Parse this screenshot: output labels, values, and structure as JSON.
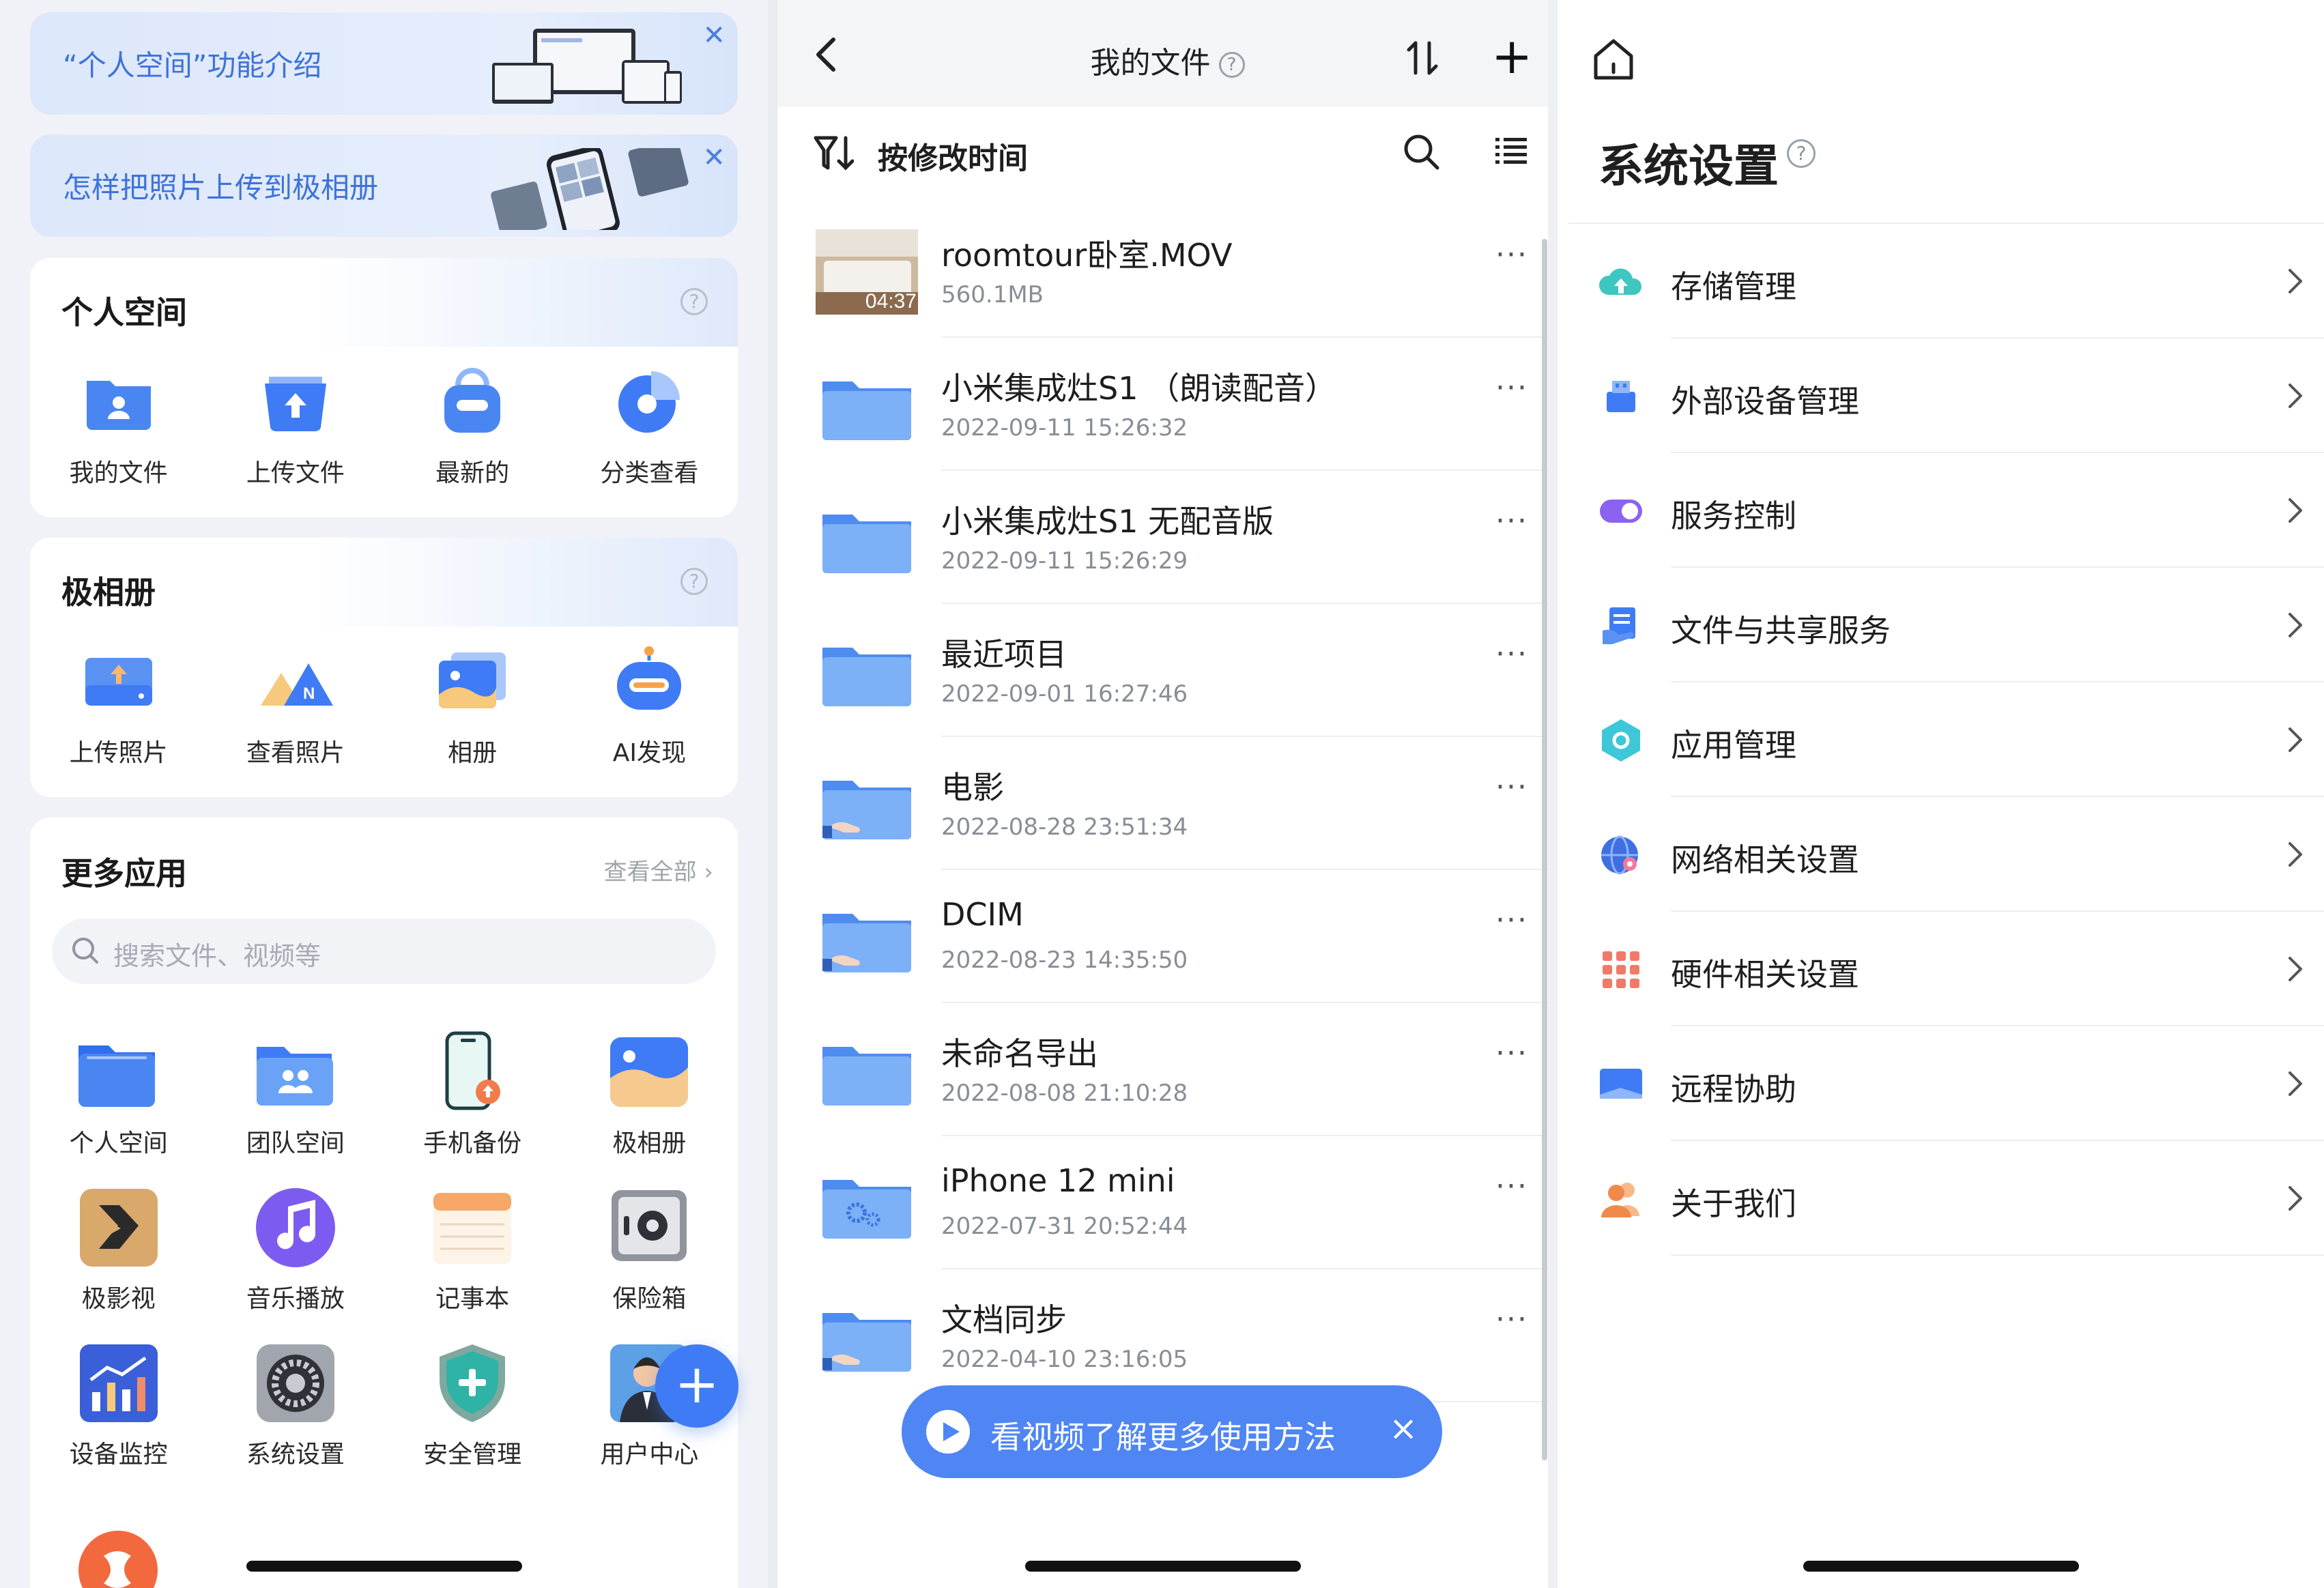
{
  "left_panel": {
    "banners": [
      {
        "text": "“个人空间”功能介绍"
      },
      {
        "text": "怎样把照片上传到极相册"
      }
    ],
    "personal_space": {
      "title": "个人空间",
      "items": [
        {
          "label": "我的文件",
          "icon": "my-files-icon"
        },
        {
          "label": "上传文件",
          "icon": "upload-file-icon"
        },
        {
          "label": "最新的",
          "icon": "recent-icon"
        },
        {
          "label": "分类查看",
          "icon": "category-icon"
        }
      ]
    },
    "album": {
      "title": "极相册",
      "items": [
        {
          "label": "上传照片",
          "icon": "upload-photo-icon"
        },
        {
          "label": "查看照片",
          "icon": "view-photos-icon"
        },
        {
          "label": "相册",
          "icon": "album-icon"
        },
        {
          "label": "AI发现",
          "icon": "ai-discover-icon"
        }
      ]
    },
    "more_apps": {
      "title": "更多应用",
      "view_all": "查看全部",
      "search_placeholder": "搜索文件、视频等",
      "items": [
        {
          "label": "个人空间",
          "icon": "personal-space-icon"
        },
        {
          "label": "团队空间",
          "icon": "team-space-icon"
        },
        {
          "label": "手机备份",
          "icon": "phone-backup-icon"
        },
        {
          "label": "极相册",
          "icon": "photo-album-icon"
        },
        {
          "label": "极影视",
          "icon": "video-icon"
        },
        {
          "label": "音乐播放",
          "icon": "music-icon"
        },
        {
          "label": "记事本",
          "icon": "notepad-icon"
        },
        {
          "label": "保险箱",
          "icon": "safe-icon"
        },
        {
          "label": "设备监控",
          "icon": "monitor-icon"
        },
        {
          "label": "系统设置",
          "icon": "settings-icon"
        },
        {
          "label": "安全管理",
          "icon": "security-icon"
        },
        {
          "label": "用户中心",
          "icon": "user-center-icon"
        }
      ]
    },
    "fab_label": "+"
  },
  "middle_panel": {
    "title": "我的文件",
    "add_label": "+",
    "sort_label": "按修改时间",
    "files": [
      {
        "name": "roomtour卧室.MOV",
        "meta": "560.1MB",
        "type": "video",
        "duration": "04:37"
      },
      {
        "name": "小米集成灶S1 （朗读配音）",
        "meta": "2022-09-11 15:26:32",
        "type": "folder"
      },
      {
        "name": "小米集成灶S1 无配音版",
        "meta": "2022-09-11 15:26:29",
        "type": "folder"
      },
      {
        "name": "最近项目",
        "meta": "2022-09-01 16:27:46",
        "type": "folder"
      },
      {
        "name": "电影",
        "meta": "2022-08-28 23:51:34",
        "type": "shared-folder"
      },
      {
        "name": "DCIM",
        "meta": "2022-08-23 14:35:50",
        "type": "shared-folder"
      },
      {
        "name": "未命名导出",
        "meta": "2022-08-08 21:10:28",
        "type": "folder"
      },
      {
        "name": "iPhone 12 mini",
        "meta": "2022-07-31 20:52:44",
        "type": "system-folder"
      },
      {
        "name": "文档同步",
        "meta": "2022-04-10 23:16:05",
        "type": "shared-folder"
      }
    ],
    "more_label": "···",
    "toast": {
      "text": "看视频了解更多使用方法",
      "close": "×"
    }
  },
  "right_panel": {
    "title": "系统设置",
    "items": [
      {
        "label": "存储管理",
        "icon": "cloud-storage-icon"
      },
      {
        "label": "外部设备管理",
        "icon": "usb-device-icon"
      },
      {
        "label": "服务控制",
        "icon": "toggle-icon"
      },
      {
        "label": "文件与共享服务",
        "icon": "file-share-icon"
      },
      {
        "label": "应用管理",
        "icon": "app-hexagon-icon"
      },
      {
        "label": "网络相关设置",
        "icon": "globe-icon"
      },
      {
        "label": "硬件相关设置",
        "icon": "hardware-grid-icon"
      },
      {
        "label": "远程协助",
        "icon": "remote-screen-icon"
      },
      {
        "label": "关于我们",
        "icon": "users-icon"
      }
    ]
  },
  "colors": {
    "accent": "#3f7bf4",
    "folder": "#6aa3f5",
    "toast": "#4f86f4",
    "banner_text": "#3d73d9"
  }
}
